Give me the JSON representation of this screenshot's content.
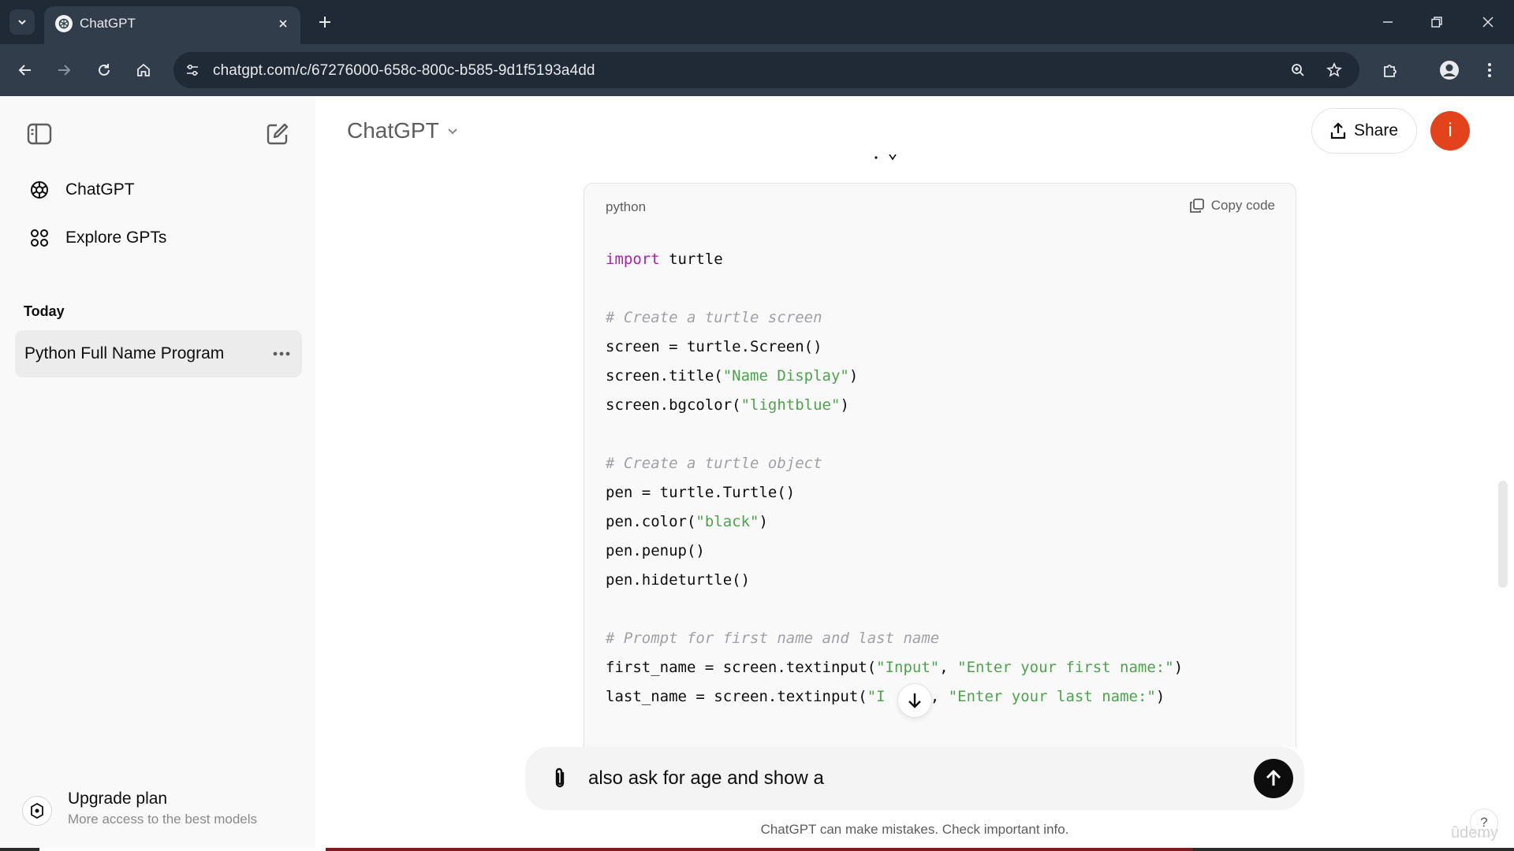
{
  "browser": {
    "tab_title": "ChatGPT",
    "url": "chatgpt.com/c/67276000-658c-800c-b585-9d1f5193a4dd"
  },
  "sidebar": {
    "items": [
      {
        "label": "ChatGPT",
        "icon": "openai-logo-icon"
      },
      {
        "label": "Explore GPTs",
        "icon": "grid-icon"
      }
    ],
    "section_label": "Today",
    "conversations": [
      {
        "label": "Python Full Name Program"
      }
    ],
    "upgrade": {
      "title": "Upgrade plan",
      "subtitle": "More access to the best models"
    }
  },
  "header": {
    "model_name": "ChatGPT",
    "share_label": "Share",
    "avatar_initial": "i",
    "avatar_color": "#e2421c"
  },
  "code_block": {
    "language": "python",
    "copy_label": "Copy code",
    "lines": {
      "l1_kw": "import",
      "l1_rest": " turtle",
      "l3": "# Create a turtle screen",
      "l4": "screen = turtle.Screen()",
      "l5_a": "screen.title(",
      "l5_s": "\"Name Display\"",
      "l5_b": ")",
      "l6_a": "screen.bgcolor(",
      "l6_s": "\"lightblue\"",
      "l6_b": ")",
      "l8": "# Create a turtle object",
      "l9": "pen = turtle.Turtle()",
      "l10_a": "pen.color(",
      "l10_s": "\"black\"",
      "l10_b": ")",
      "l11": "pen.penup()",
      "l12": "pen.hideturtle()",
      "l14": "# Prompt for first name and last name",
      "l15_a": "first_name = screen.textinput(",
      "l15_s1": "\"Input\"",
      "l15_m": ", ",
      "l15_s2": "\"Enter your first name:\"",
      "l15_b": ")",
      "l16_a": "last_name = screen.textinput(",
      "l16_s1": "\"I",
      "l16_gap": "    ",
      "l16_s1b": "\"",
      "l16_m": ", ",
      "l16_s2": "\"Enter your last name:\"",
      "l16_b": ")"
    }
  },
  "composer": {
    "value": "also ask for age and show a"
  },
  "disclaimer": "ChatGPT can make mistakes. Check important info.",
  "help_label": "?",
  "watermark": "ûdemy"
}
